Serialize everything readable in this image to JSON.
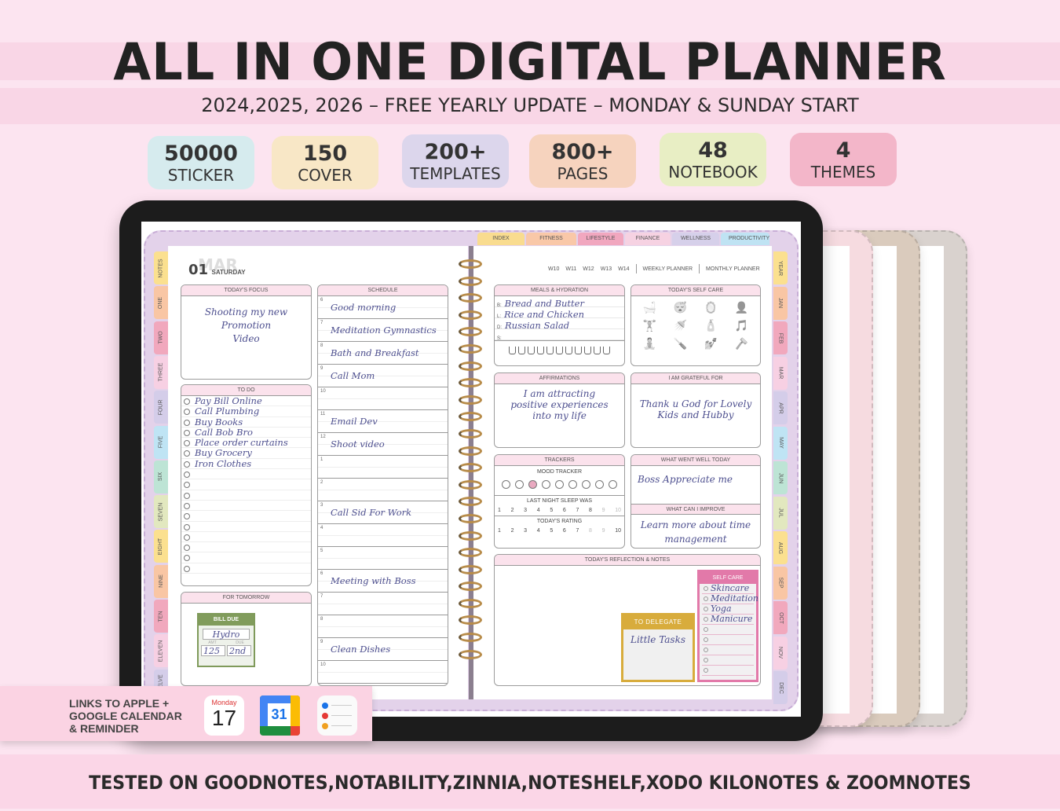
{
  "header": {
    "title": "ALL IN ONE DIGITAL PLANNER",
    "subtitle": "2024,2025, 2026 – FREE YEARLY UPDATE – MONDAY & SUNDAY START"
  },
  "badges": [
    {
      "num": "50000",
      "label": "STICKER",
      "color": "#d6ebee"
    },
    {
      "num": "150",
      "label": "COVER",
      "color": "#f8e7c6"
    },
    {
      "num": "200+",
      "label": "TEMPLATES",
      "color": "#dcd6ec"
    },
    {
      "num": "800+",
      "label": "PAGES",
      "color": "#f6d3be"
    },
    {
      "num": "48",
      "label": "NOTEBOOK",
      "color": "#e8eec4"
    },
    {
      "num": "4",
      "label": "THEMES",
      "color": "#f3b6c9"
    }
  ],
  "planner": {
    "top_tabs": [
      {
        "label": "INDEX",
        "color": "#f9dc8f"
      },
      {
        "label": "FITNESS",
        "color": "#f9c8a8"
      },
      {
        "label": "LIFESTYLE",
        "color": "#f1a7bf"
      },
      {
        "label": "FINANCE",
        "color": "#f6d2e2"
      },
      {
        "label": "WELLNESS",
        "color": "#d6d0ea"
      },
      {
        "label": "PRODUCTIVITY",
        "color": "#bfe3f3"
      }
    ],
    "left_tabs": [
      {
        "label": "NOTES",
        "color": "#fbe08f"
      },
      {
        "label": "ONE",
        "color": "#f9c6a4"
      },
      {
        "label": "TWO",
        "color": "#f1a8bd"
      },
      {
        "label": "THREE",
        "color": "#f7d0e3"
      },
      {
        "label": "FOUR",
        "color": "#d4cde9"
      },
      {
        "label": "FIVE",
        "color": "#bfe4f4"
      },
      {
        "label": "SIX",
        "color": "#bde4d5"
      },
      {
        "label": "SEVEN",
        "color": "#e2e8bf"
      },
      {
        "label": "EIGHT",
        "color": "#fbe08f"
      },
      {
        "label": "NINE",
        "color": "#f9c6a4"
      },
      {
        "label": "TEN",
        "color": "#f1a8bd"
      },
      {
        "label": "ELEVEN",
        "color": "#f7d0e3"
      },
      {
        "label": "TWELVE",
        "color": "#d4cde9"
      }
    ],
    "right_tabs": [
      {
        "label": "YEAR",
        "color": "#fbe08f"
      },
      {
        "label": "JAN",
        "color": "#f9c6a4"
      },
      {
        "label": "FEB",
        "color": "#f1a8bd"
      },
      {
        "label": "MAR",
        "color": "#f7d0e3"
      },
      {
        "label": "APR",
        "color": "#d4cde9"
      },
      {
        "label": "MAY",
        "color": "#bfe4f4"
      },
      {
        "label": "JUN",
        "color": "#bde4d5"
      },
      {
        "label": "JUL",
        "color": "#e2e8bf"
      },
      {
        "label": "AUG",
        "color": "#fbe08f"
      },
      {
        "label": "SEP",
        "color": "#f9c6a4"
      },
      {
        "label": "OCT",
        "color": "#f1a8bd"
      },
      {
        "label": "NOV",
        "color": "#f7d0e3"
      },
      {
        "label": "DEC",
        "color": "#d4cde9"
      }
    ],
    "date": {
      "month": "MAR",
      "day": "01",
      "weekday": "SATURDAY"
    },
    "week_nav": [
      "W10",
      "W11",
      "W12",
      "W13",
      "W14"
    ],
    "weekly_link": "WEEKLY PLANNER",
    "monthly_link": "MONTHLY PLANNER",
    "focus": {
      "title": "TODAY'S FOCUS",
      "lines": [
        "Shooting my new",
        "Promotion",
        "Video"
      ]
    },
    "todo": {
      "title": "TO DO",
      "items": [
        "Pay Bill Online",
        "Call Plumbing",
        "Buy Books",
        "Call Bob Bro",
        "Place order curtains",
        "Buy Grocery",
        "Iron Clothes",
        "",
        "",
        "",
        "",
        "",
        "",
        "",
        "",
        "",
        ""
      ]
    },
    "tomorrow": {
      "title": "FOR TOMORROW",
      "bill_title": "BILL DUE",
      "bill_name": "Hydro",
      "amt_label": "AMT",
      "due_label": "DUE",
      "amt": "125",
      "due": "2nd"
    },
    "schedule": {
      "title": "SCHEDULE",
      "rows": [
        {
          "hour": "6",
          "text": "Good morning"
        },
        {
          "hour": "7",
          "text": "Meditation Gymnastics"
        },
        {
          "hour": "8",
          "text": "Bath and Breakfast"
        },
        {
          "hour": "9",
          "text": "Call Mom"
        },
        {
          "hour": "10",
          "text": ""
        },
        {
          "hour": "11",
          "text": "Email Dev"
        },
        {
          "hour": "12",
          "text": "Shoot video"
        },
        {
          "hour": "1",
          "text": ""
        },
        {
          "hour": "2",
          "text": ""
        },
        {
          "hour": "3",
          "text": "Call Sid For Work"
        },
        {
          "hour": "4",
          "text": ""
        },
        {
          "hour": "5",
          "text": ""
        },
        {
          "hour": "6",
          "text": "Meeting with Boss"
        },
        {
          "hour": "7",
          "text": ""
        },
        {
          "hour": "8",
          "text": ""
        },
        {
          "hour": "9",
          "text": "Clean Dishes"
        },
        {
          "hour": "10",
          "text": ""
        }
      ]
    },
    "meals": {
      "title": "MEALS & HYDRATION",
      "rows": [
        {
          "k": "B:",
          "v": "Bread and Butter"
        },
        {
          "k": "L:",
          "v": "Rice and Chicken"
        },
        {
          "k": "D:",
          "v": "Russian Salad"
        },
        {
          "k": "S:",
          "v": ""
        }
      ],
      "water_cups": 11
    },
    "selfcare_icons": {
      "title": "TODAY'S SELF CARE",
      "icons": [
        "bathtub-icon",
        "sleep-mask-icon",
        "mirror-icon",
        "face-mask-icon",
        "dumbbell-icon",
        "shower-icon",
        "cream-tube-icon",
        "music-phone-icon",
        "meditation-icon",
        "tweezers-icon",
        "nail-polish-icon",
        "razor-icon"
      ]
    },
    "affirmations": {
      "title": "AFFIRMATIONS",
      "lines": [
        "I am attracting",
        "positive experiences",
        "into my life"
      ]
    },
    "grateful": {
      "title": "I AM GRATEFUL FOR",
      "lines": [
        "Thank u God for Lovely",
        "Kids and Hubby"
      ]
    },
    "trackers": {
      "title": "TRACKERS",
      "mood_label": "MOOD TRACKER",
      "mood_count": 9,
      "mood_selected": 3,
      "sleep_label": "LAST NIGHT SLEEP WAS",
      "sleep_scale": [
        "1",
        "2",
        "3",
        "4",
        "5",
        "6",
        "7",
        "8",
        "9",
        "10"
      ],
      "sleep_value": 8,
      "rating_label": "TODAY'S RATING",
      "rating_scale": [
        "1",
        "2",
        "3",
        "4",
        "5",
        "6",
        "7",
        "8",
        "9",
        "10"
      ],
      "rating_value": 7
    },
    "went_well": {
      "title": "WHAT WENT WELL TODAY",
      "text": "Boss Appreciate me"
    },
    "improve": {
      "title": "WHAT CAN I IMPROVE",
      "lines": [
        "Learn more about time",
        "management"
      ]
    },
    "reflection": {
      "title": "TODAY'S REFLECTION & NOTES"
    },
    "delegate": {
      "title": "TO DELEGATE",
      "text": "Little Tasks"
    },
    "selfcare_list": {
      "title": "SELF CARE",
      "items": [
        "Skincare",
        "Meditation",
        "Yoga",
        "Manicure",
        "",
        "",
        "",
        "",
        ""
      ]
    }
  },
  "ghost_tab_label": "VITY",
  "ghost_header_fragment": "ER",
  "ghost_tabs": [
    "YEAR",
    "JAN",
    "FEB",
    "MAR",
    "APR",
    "MAY",
    "JUN",
    "JUL",
    "AUG",
    "SEP",
    "OCT",
    "NOV",
    "DEC"
  ],
  "links": {
    "text_lines": [
      "LINKS TO APPLE +",
      "GOOGLE CALENDAR",
      "& REMINDER"
    ],
    "apple_cal": {
      "weekday": "Monday",
      "day": "17"
    },
    "google_cal": {
      "day": "31"
    }
  },
  "footer": {
    "text": "TESTED ON GOODNOTES,NOTABILITY,ZINNIA,NOTESHELF,XODO KILONOTES & ZOOMNOTES"
  }
}
